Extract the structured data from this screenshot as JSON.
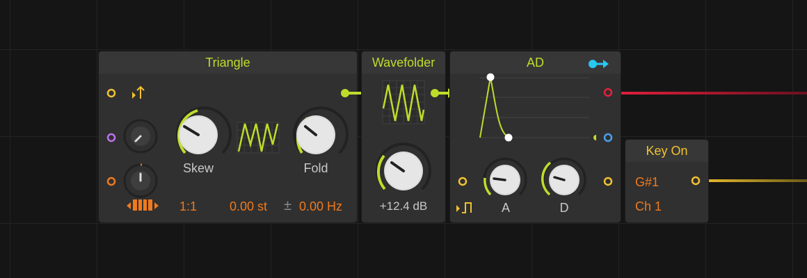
{
  "triangle": {
    "title": "Triangle",
    "skew_label": "Skew",
    "fold_label": "Fold",
    "ratio": "1:1",
    "semitones": "0.00 st",
    "plusminus": "±",
    "hz": "0.00 Hz",
    "icons": [
      "pitch-up-icon",
      "keyboard-icon"
    ]
  },
  "wavefolder": {
    "title": "Wavefolder",
    "gain": "+12.4 dB"
  },
  "ad": {
    "title": "AD",
    "attack_label": "A",
    "decay_label": "D",
    "icons": [
      "output-arrow-icon",
      "gate-icon"
    ]
  },
  "keyon": {
    "title": "Key On",
    "note": "G#1",
    "channel": "Ch 1"
  },
  "colors": {
    "lime": "#c0dc2a",
    "orange": "#f07a1e",
    "gold": "#f2c230",
    "purple": "#c070f0",
    "red": "#e8203c",
    "blue": "#4aa0f0",
    "cyan": "#28c8f0"
  }
}
